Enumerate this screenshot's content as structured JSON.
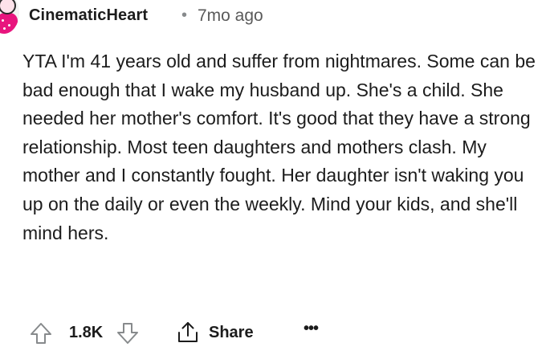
{
  "comment": {
    "author": "CinematicHeart",
    "separator": "•",
    "timestamp": "7mo ago",
    "avatar_accent": "#e8157e",
    "text": "YTA I'm 41 years old and suffer from nightmares. Some can be bad enough that I wake my husband up. She's a child. She needed her mother's comfort. It's good that they have a strong relationship. Most teen daughters and mothers clash. My mother and I constantly fought. Her daughter isn't waking you up on the daily or even the weekly. Mind your kids, and she'll mind hers."
  },
  "actions": {
    "upvote_icon": "upvote-arrow-icon",
    "score": "1.8K",
    "downvote_icon": "downvote-arrow-icon",
    "share_icon": "share-icon",
    "share_label": "Share",
    "more_icon": "more-options-icon",
    "more_label": "•••"
  }
}
